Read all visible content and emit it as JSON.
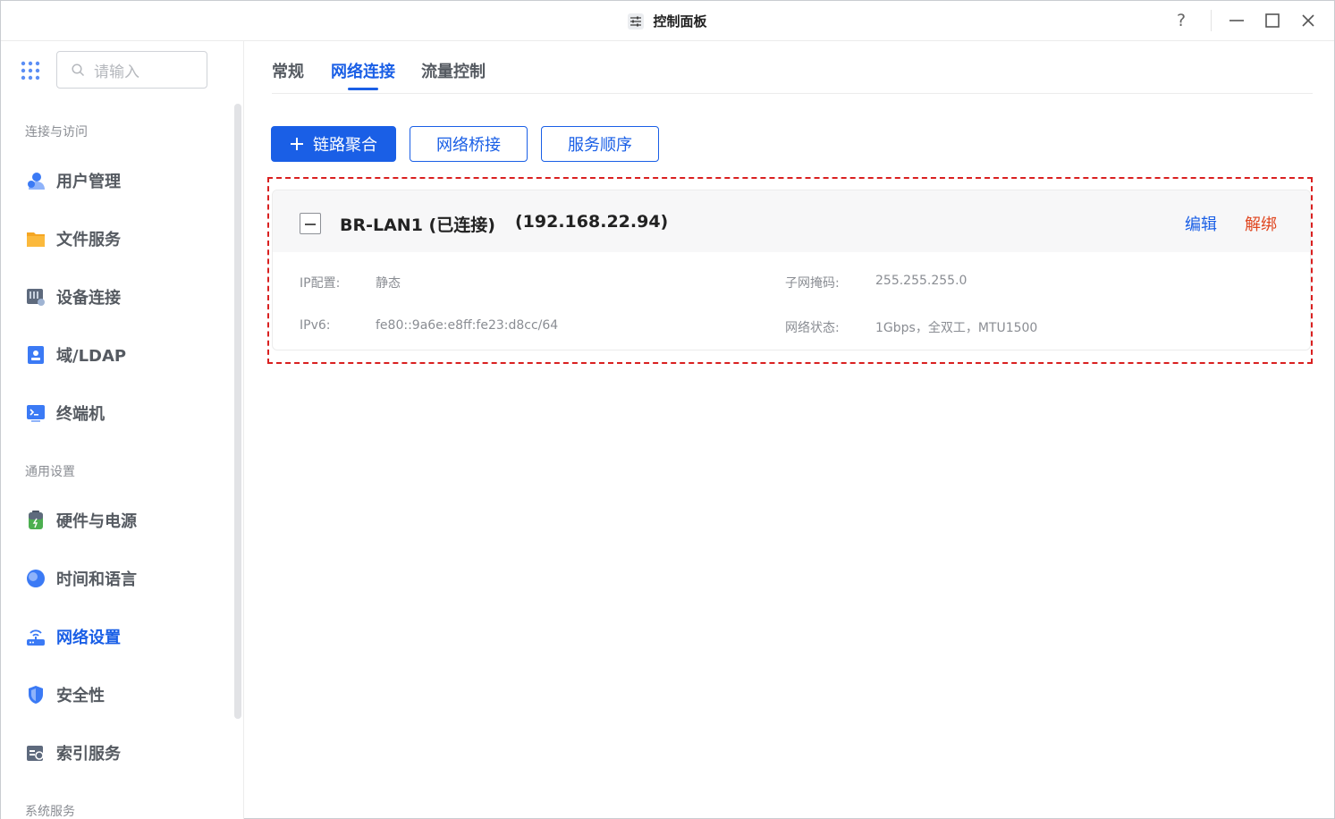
{
  "window": {
    "title": "控制面板"
  },
  "titlebar": {
    "help": "?",
    "minimize": "—",
    "maximize": "☐",
    "close": "✕"
  },
  "sidebar": {
    "search_placeholder": "请输入",
    "sections": [
      {
        "label": "连接与访问"
      },
      {
        "label": "通用设置"
      },
      {
        "label": "系统服务"
      }
    ],
    "items": [
      {
        "label": "用户管理",
        "icon": "users-icon"
      },
      {
        "label": "文件服务",
        "icon": "folder-icon"
      },
      {
        "label": "设备连接",
        "icon": "device-icon"
      },
      {
        "label": "域/LDAP",
        "icon": "id-card-icon"
      },
      {
        "label": "终端机",
        "icon": "terminal-icon"
      },
      {
        "label": "硬件与电源",
        "icon": "battery-icon"
      },
      {
        "label": "时间和语言",
        "icon": "globe-icon"
      },
      {
        "label": "网络设置",
        "icon": "router-icon",
        "active": true
      },
      {
        "label": "安全性",
        "icon": "shield-icon"
      },
      {
        "label": "索引服务",
        "icon": "index-icon"
      }
    ]
  },
  "tabs": [
    {
      "label": "常规"
    },
    {
      "label": "网络连接",
      "active": true
    },
    {
      "label": "流量控制"
    }
  ],
  "toolbar": {
    "link_aggregation": "链路聚合",
    "network_bridge": "网络桥接",
    "service_order": "服务顺序"
  },
  "connection": {
    "name": "BR-LAN1 (已连接)",
    "ip": "(192.168.22.94)",
    "edit": "编辑",
    "unbind": "解绑",
    "ip_config_label": "IP配置:",
    "ip_config_value": "静态",
    "ipv6_label": "IPv6:",
    "ipv6_value": "fe80::9a6e:e8ff:fe23:d8cc/64",
    "subnet_label": "子网掩码:",
    "subnet_value": "255.255.255.0",
    "status_label": "网络状态:",
    "status_value": "1Gbps，全双工，MTU1500"
  },
  "colors": {
    "accent": "#1a5fe6",
    "danger": "#e0461f",
    "highlight": "#d92020"
  }
}
